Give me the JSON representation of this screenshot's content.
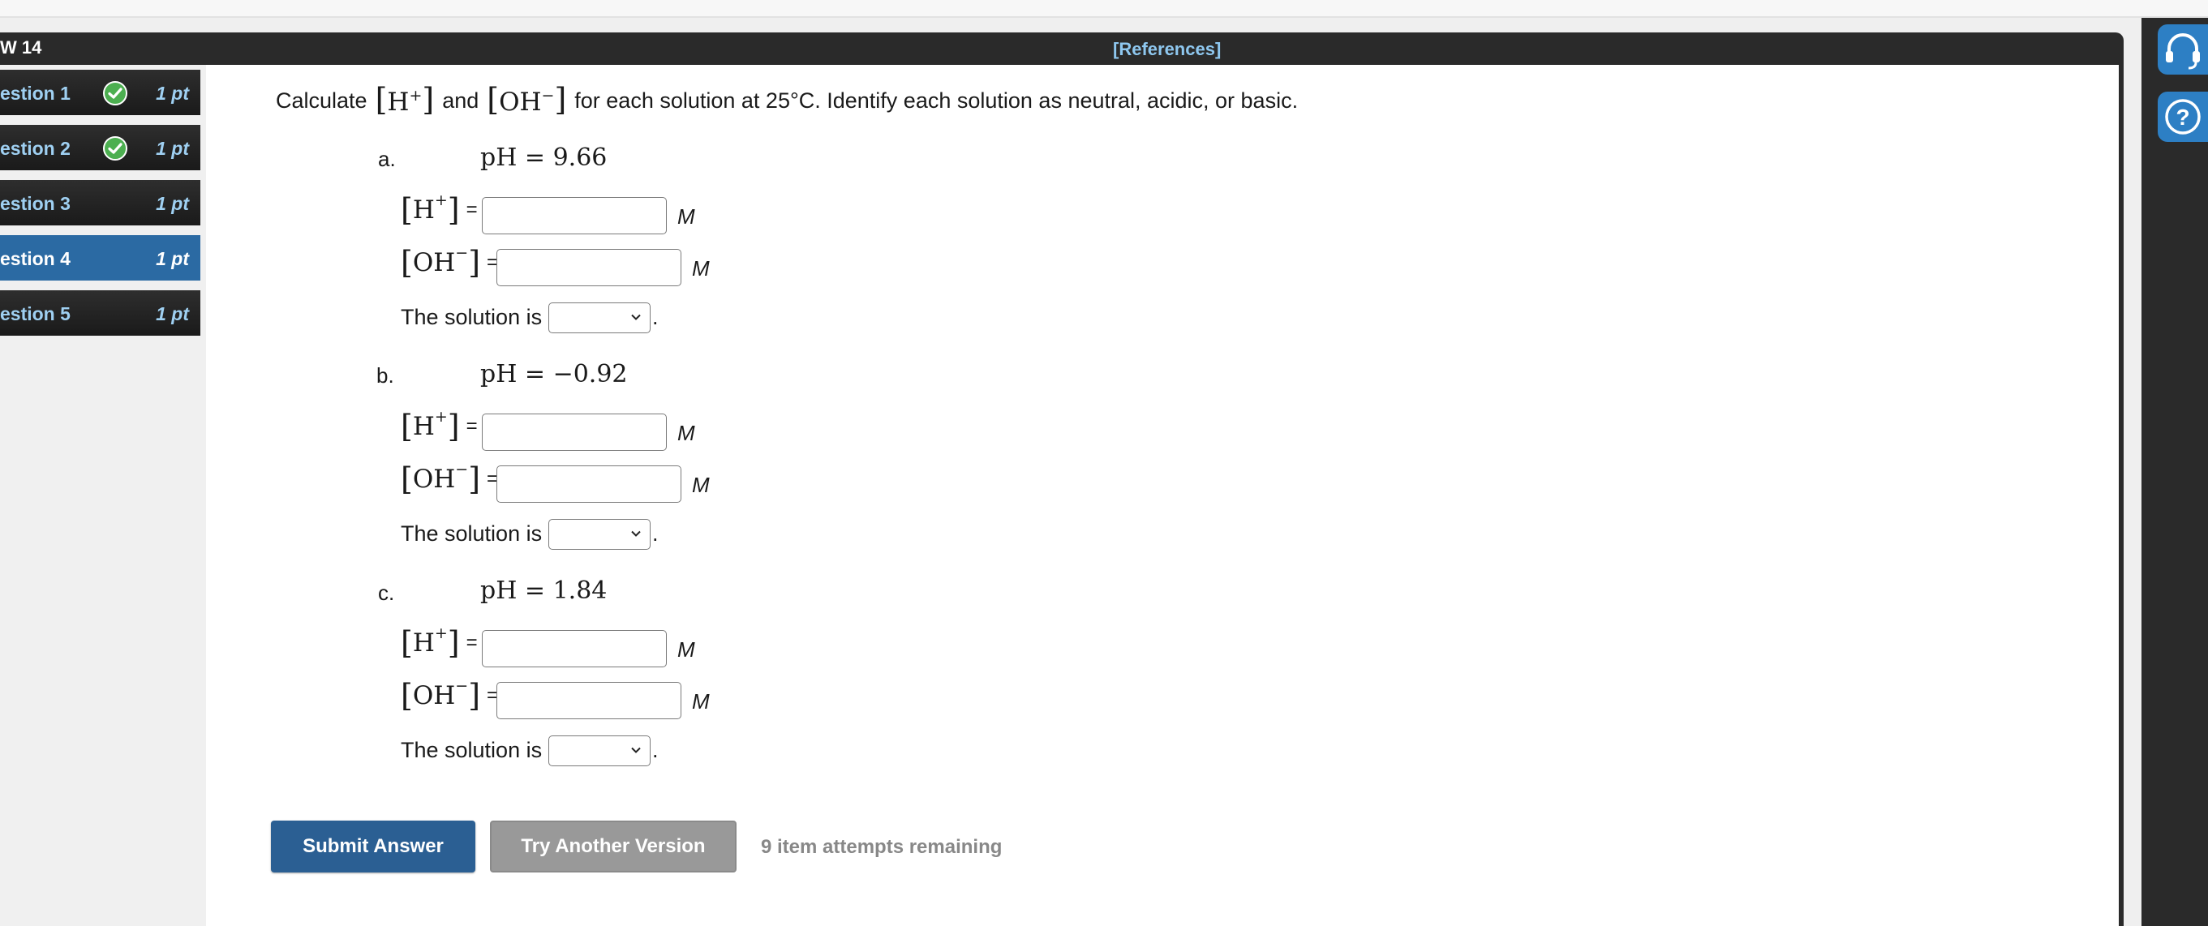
{
  "header": {
    "assignment_title": "W 14",
    "references_label": "[References]"
  },
  "questions": [
    {
      "label": "estion 1",
      "points": "1 pt",
      "completed": true,
      "active": false
    },
    {
      "label": "estion 2",
      "points": "1 pt",
      "completed": true,
      "active": false
    },
    {
      "label": "estion 3",
      "points": "1 pt",
      "completed": false,
      "active": false
    },
    {
      "label": "estion 4",
      "points": "1 pt",
      "completed": false,
      "active": true
    },
    {
      "label": "estion 5",
      "points": "1 pt",
      "completed": false,
      "active": false
    }
  ],
  "problem": {
    "prefix": "Calculate",
    "h_symbol": "H",
    "h_charge": "+",
    "and_word": "and",
    "oh_symbol": "OH",
    "oh_charge": "−",
    "suffix": "for each solution at 25°C. Identify each solution as neutral, acidic, or basic."
  },
  "parts": [
    {
      "letter": "a.",
      "ph_text": "pH = 9.66",
      "h_value": "",
      "oh_value": "",
      "solution_value": ""
    },
    {
      "letter": "b.",
      "ph_text": "pH = −0.92",
      "h_value": "",
      "oh_value": "",
      "solution_value": ""
    },
    {
      "letter": "c.",
      "ph_text": "pH = 1.84",
      "h_value": "",
      "oh_value": "",
      "solution_value": ""
    }
  ],
  "row_labels": {
    "h": "H",
    "h_charge": "+",
    "oh": "OH",
    "oh_charge": "−",
    "equals": "=",
    "unit": "M",
    "solution_prefix": "The solution is",
    "period": "."
  },
  "buttons": {
    "submit": "Submit Answer",
    "try_another": "Try Another Version",
    "attempts": "9 item attempts remaining"
  },
  "tools": [
    {
      "icon": "headset-icon"
    },
    {
      "icon": "help-icon"
    }
  ],
  "colors": {
    "active_question": "#2b6aa3",
    "link": "#8ec7ef",
    "submit_button": "#2b5f93",
    "secondary_button": "#999999",
    "check": "#4caf50",
    "tool_button": "#2d7fc4"
  }
}
